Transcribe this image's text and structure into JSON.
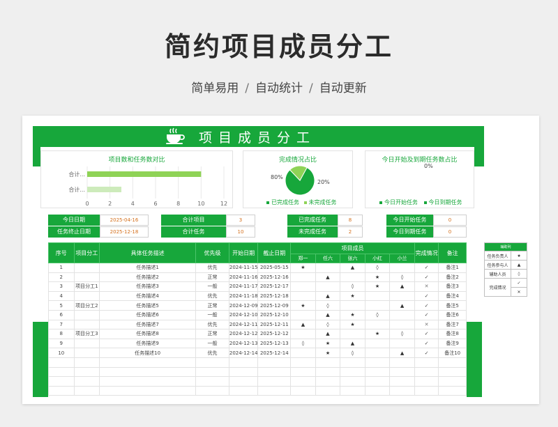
{
  "header": {
    "title": "简约项目成员分工",
    "tags": [
      "简单易用",
      "自动统计",
      "自动更新"
    ],
    "separator": "/"
  },
  "banner": {
    "title": "项目成员分工",
    "icon": "coffee-cup-icon"
  },
  "colors": {
    "accent": "#17a73b",
    "accent_light": "#8fd356",
    "value_text": "#d46f1b"
  },
  "charts": {
    "compare": {
      "title": "项目数和任务数对比",
      "ticks": [
        "0",
        "2",
        "4",
        "6",
        "8",
        "10",
        "12"
      ]
    },
    "completion": {
      "title": "完成情况占比",
      "legend": [
        "已完成任务",
        "未完成任务"
      ]
    },
    "today": {
      "title": "今日开始及到期任务数占比",
      "pct": "0%",
      "legend": [
        "今日开始任务",
        "今日到期任务"
      ]
    }
  },
  "chart_data": [
    {
      "type": "bar",
      "orientation": "horizontal",
      "title": "项目数和任务数对比",
      "categories": [
        "合计...",
        "合计..."
      ],
      "values": [
        10,
        3
      ],
      "xlim": [
        0,
        12
      ]
    },
    {
      "type": "pie",
      "title": "完成情况占比",
      "labels": [
        "已完成任务",
        "未完成任务"
      ],
      "values": [
        80,
        20
      ],
      "value_labels": [
        "80%",
        "20%"
      ]
    },
    {
      "type": "pie",
      "title": "今日开始及到期任务数占比",
      "labels": [
        "今日开始任务",
        "今日到期任务"
      ],
      "values": [
        0,
        0
      ],
      "value_labels": [
        "0%",
        "0%"
      ]
    }
  ],
  "summary": {
    "today_label": "今日日期",
    "today_value": "2025-04-16",
    "end_label": "任务终止日期",
    "end_value": "2025-12-18",
    "total_projects_label": "合计项目",
    "total_projects_value": "3",
    "total_tasks_label": "合计任务",
    "total_tasks_value": "10",
    "done_label": "已完成任务",
    "done_value": "8",
    "undone_label": "未完成任务",
    "undone_value": "2",
    "start_today_label": "今日开始任务",
    "start_today_value": "0",
    "due_today_label": "今日到期任务",
    "due_today_value": "0"
  },
  "table": {
    "headers": {
      "no": "序号",
      "project": "项目分工",
      "desc": "具体任务描述",
      "priority": "优先级",
      "start": "开始日期",
      "end": "截止日期",
      "members": "项目成员",
      "status": "完成情况",
      "note": "备注"
    },
    "member_names": [
      "郑一",
      "任六",
      "张六",
      "小红",
      "小兰"
    ],
    "rows": [
      {
        "no": "1",
        "project": "",
        "desc": "任务描述1",
        "priority": "优先",
        "start": "2024-11-15",
        "end": "2025-05-15",
        "m": [
          "★",
          "",
          "▲",
          "◊",
          ""
        ],
        "status": "✓",
        "note": "备注1"
      },
      {
        "no": "2",
        "project": "",
        "desc": "任务描述2",
        "priority": "正常",
        "start": "2024-11-16",
        "end": "2025-12-16",
        "m": [
          "",
          "▲",
          "",
          "★",
          "◊"
        ],
        "status": "✓",
        "note": "备注2"
      },
      {
        "no": "3",
        "project": "项目分工1",
        "desc": "任务描述3",
        "priority": "一般",
        "start": "2024-11-17",
        "end": "2025-12-17",
        "m": [
          "",
          "",
          "◊",
          "★",
          "▲"
        ],
        "status": "✕",
        "note": "备注3"
      },
      {
        "no": "4",
        "project": "",
        "desc": "任务描述4",
        "priority": "优先",
        "start": "2024-11-18",
        "end": "2025-12-18",
        "m": [
          "",
          "▲",
          "★",
          "",
          ""
        ],
        "status": "✓",
        "note": "备注4"
      },
      {
        "no": "5",
        "project": "项目分工2",
        "desc": "任务描述5",
        "priority": "正常",
        "start": "2024-12-09",
        "end": "2025-12-09",
        "m": [
          "★",
          "◊",
          "",
          "",
          "▲"
        ],
        "status": "✓",
        "note": "备注5"
      },
      {
        "no": "6",
        "project": "",
        "desc": "任务描述6",
        "priority": "一般",
        "start": "2024-12-10",
        "end": "2025-12-10",
        "m": [
          "",
          "▲",
          "★",
          "◊",
          ""
        ],
        "status": "✓",
        "note": "备注6"
      },
      {
        "no": "7",
        "project": "",
        "desc": "任务描述7",
        "priority": "优先",
        "start": "2024-12-11",
        "end": "2025-12-11",
        "m": [
          "▲",
          "◊",
          "★",
          "",
          ""
        ],
        "status": "✕",
        "note": "备注7"
      },
      {
        "no": "8",
        "project": "项目分工3",
        "desc": "任务描述8",
        "priority": "正常",
        "start": "2024-12-12",
        "end": "2025-12-12",
        "m": [
          "",
          "▲",
          "",
          "★",
          "◊"
        ],
        "status": "✓",
        "note": "备注8"
      },
      {
        "no": "9",
        "project": "",
        "desc": "任务描述9",
        "priority": "一般",
        "start": "2024-12-13",
        "end": "2025-12-13",
        "m": [
          "◊",
          "★",
          "▲",
          "",
          ""
        ],
        "status": "✓",
        "note": "备注9"
      },
      {
        "no": "10",
        "project": "",
        "desc": "任务描述10",
        "priority": "优先",
        "start": "2024-12-14",
        "end": "2025-12-14",
        "m": [
          "",
          "★",
          "◊",
          "",
          "▲"
        ],
        "status": "✓",
        "note": "备注10"
      }
    ]
  },
  "legend_table": {
    "title": "辅助列",
    "items": [
      {
        "label": "任务负责人",
        "symbol": "★"
      },
      {
        "label": "任务参与人",
        "symbol": "▲"
      },
      {
        "label": "辅助人员",
        "symbol": "◊"
      }
    ],
    "status_label": "完成情况",
    "status_symbols": [
      "✓",
      "✕"
    ]
  }
}
